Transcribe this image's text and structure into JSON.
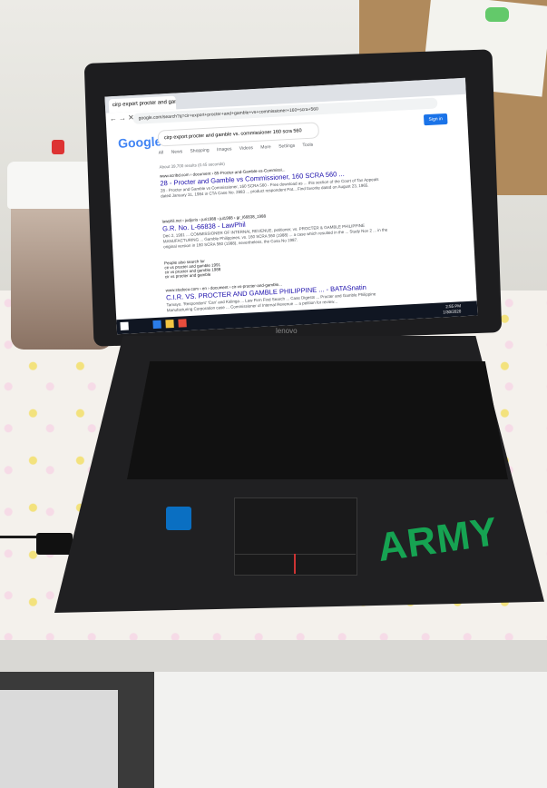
{
  "browser": {
    "tab_title": "cirp export procter and gamble  ×",
    "address": "google.com/search?q=cir+export+procter+and+gamble+vs+commissioner+160+scra+560",
    "search_query": "cirp export procter and gamble vs. commissioner 160 scra 560",
    "signin_label": "Sign in",
    "nav_back": "←",
    "nav_forward": "→",
    "nav_close": "✕"
  },
  "search_tabs": [
    "All",
    "News",
    "Shopping",
    "Images",
    "Videos",
    "More",
    "Settings",
    "Tools"
  ],
  "stats": "About 39,700 results (0.45 seconds)",
  "results": [
    {
      "url": "www.scribd.com › document › 85-Procter-and-Gamble-vs-Commissi...",
      "title": "28 - Procter and Gamble vs Commissioner, 160 SCRA 560 ...",
      "snippet": "28 - Procter and Gamble vs Commissioner, 160 SCRA 560 - Free download as ... this section of the Court of Tax Appeals dated January 31, 1984 in CTA Case No. 2883 ... product respondent Pat... Find favorite dated on August 23, 1965."
    },
    {
      "url": "lawphil.net › judjuris › juri1988 › jul1988 › gr_l66838_1988",
      "title": "G.R. No. L-66838 - LawPhil",
      "snippet": "Dec 2, 1991 ... COMMISSIONER OF INTERNAL REVENUE, petitioner, vs. PROCTER & GAMBLE PHILIPPINE MANUFACTURING ... Gamble Philippines, vs. 160 SCRA 560 (1988) ... a case which resulted in the ... Study Nov 2 ... in the original version in 160 SCRA 560 (1988), nevertheless, the Cosa No 1987."
    }
  ],
  "people_also_search": {
    "heading": "People also search for",
    "items": [
      "cir vs procter and gamble 1991",
      "cir vs procter and gamble 1988",
      "cir vs procter and gamble",
      "cir vs procter and gamble 160 scra",
      "cir vs procter and gamble case 1991",
      "cir vs procter and gamble digest"
    ]
  },
  "third_result": {
    "url": "www.studocu.com › en › document › cir-vs-procter-and-gamble...",
    "title": "C.I.R. VS. PROCTER AND GAMBLE PHILIPPINE ... - BATASnatin",
    "snippet": "Tamayo. 'Respondent' 'Can' and Kalinga ... Law Firm Find Search ... Case Digests ... Procter and Gamble Philippine Manufacturing Corporation case ... Commissioner of Internal Revenue ... a petition for review..."
  },
  "taskbar": {
    "time": "2:55 PM",
    "date": "1/30/2020"
  },
  "laptop": {
    "brand": "lenovo",
    "sticker": "ARMY",
    "badge": "intel"
  },
  "colors": {
    "google_blue": "#4285f4",
    "link": "#1a0dab",
    "sticker": "#16a352",
    "laptop": "#1d1d1f"
  }
}
